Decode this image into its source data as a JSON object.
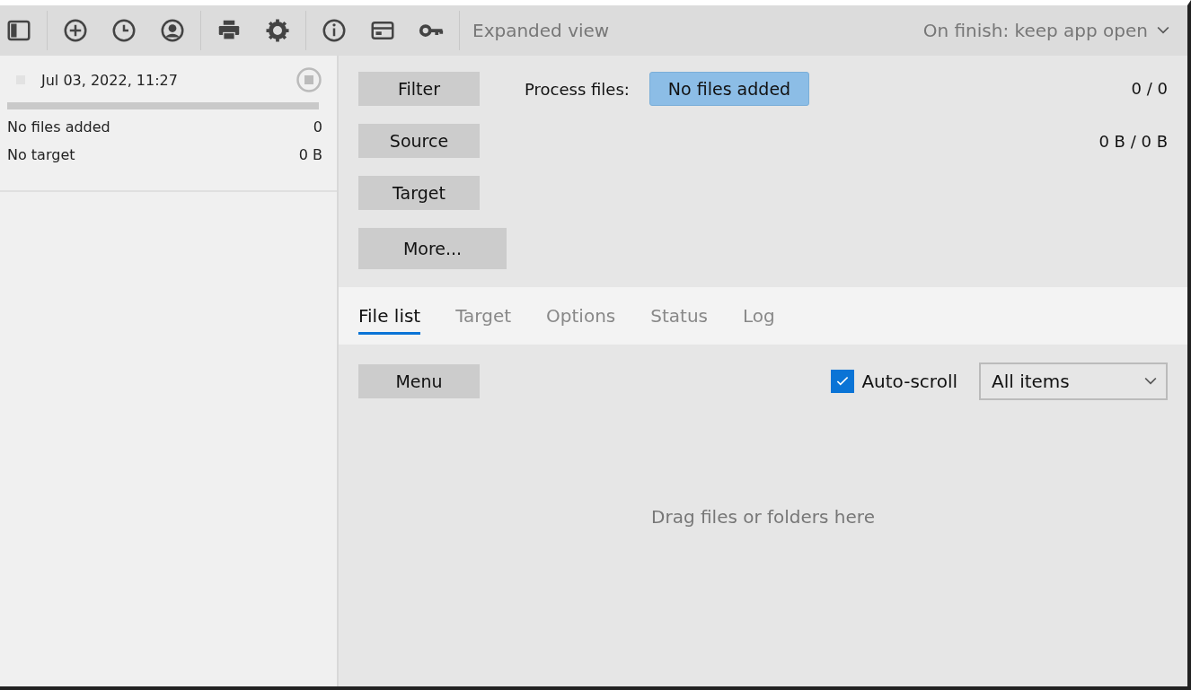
{
  "toolbar": {
    "view_label": "Expanded view",
    "on_finish": "On finish: keep app open"
  },
  "job": {
    "date": "Jul 03, 2022, 11:27",
    "level": 0,
    "files_label": "No files added",
    "files_count": "0",
    "target_label": "No target",
    "target_size": "0 B"
  },
  "actions": {
    "buttons": [
      "Filter",
      "Source",
      "Target",
      "More..."
    ],
    "process_label": "Process files:",
    "process_value": "No files added",
    "count": "0 / 0",
    "size": "0 B / 0 B"
  },
  "tabs": [
    {
      "label": "File list",
      "selected": true
    },
    {
      "label": "Target",
      "selected": false
    },
    {
      "label": "Options",
      "selected": false
    },
    {
      "label": "Status",
      "selected": false
    },
    {
      "label": "Log",
      "selected": false
    }
  ],
  "file_list": {
    "menu_button": "Menu",
    "auto_scroll": {
      "label": "Auto-scroll",
      "checked": true
    },
    "filter_value": "All items",
    "empty_text": "Drag files or folders here"
  }
}
